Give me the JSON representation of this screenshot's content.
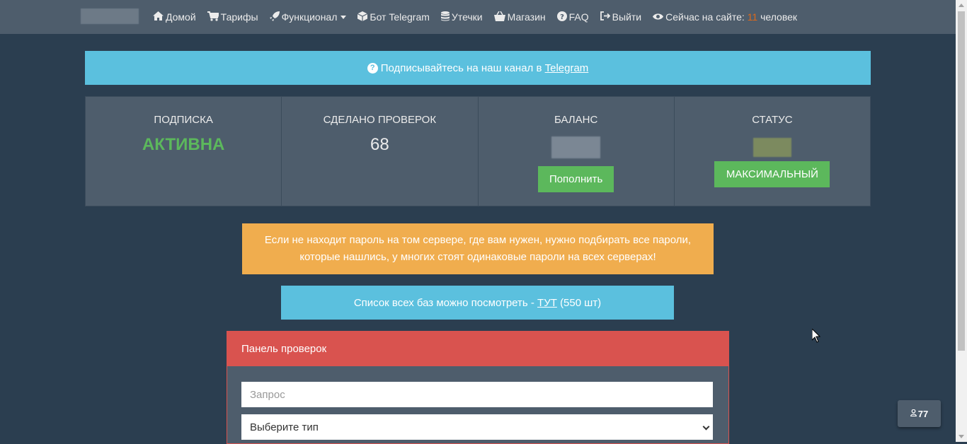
{
  "nav": {
    "items": [
      {
        "icon": "home-icon",
        "glyph": "⌂",
        "label": "Домой"
      },
      {
        "icon": "cart-icon",
        "glyph": "🛒",
        "label": "Тарифы"
      },
      {
        "icon": "rocket-icon",
        "glyph": "🚀",
        "label": "Функционал",
        "dropdown": true
      },
      {
        "icon": "cube-icon",
        "glyph": "⬢",
        "label": "Бот Telegram"
      },
      {
        "icon": "database-icon",
        "glyph": "≣",
        "label": "Утечки"
      },
      {
        "icon": "basket-icon",
        "glyph": "🧺",
        "label": "Магазин"
      },
      {
        "icon": "question-circle-icon",
        "glyph": "?",
        "label": "FAQ"
      },
      {
        "icon": "sign-out-icon",
        "glyph": "⇥",
        "label": "Выйти"
      }
    ],
    "online": {
      "prefix": "Сейчас на сайте:",
      "count": "11",
      "suffix": "человек"
    }
  },
  "telegram_banner": {
    "text": "Подписывайтесь на наш канал в",
    "link": "Telegram"
  },
  "stats": {
    "subscription": {
      "title": "ПОДПИСКА",
      "value": "АКТИВНА"
    },
    "checks": {
      "title": "СДЕЛАНО ПРОВЕРОК",
      "value": "68"
    },
    "balance": {
      "title": "БАЛАНС",
      "button": "Пополнить"
    },
    "status": {
      "title": "СТАТУС",
      "button": "МАКСИМАЛЬНЫЙ"
    }
  },
  "warning": {
    "line1": "Если не находит пароль на том сервере, где вам нужен, нужно подбирать все пароли,",
    "line2": "которые нашлись, у многих стоят одинаковые пароли на всех серверах!"
  },
  "bases": {
    "prefix": "Список всех баз можно посмотреть -",
    "link": "ТУТ",
    "suffix": "(550 шт)"
  },
  "check_panel": {
    "title": "Панель проверок",
    "query_placeholder": "Запрос",
    "type_select": "Выберите тип"
  },
  "online_badge": {
    "count": "77"
  },
  "colors": {
    "background": "#2b3e50",
    "navbar": "#4e5d6c",
    "info": "#5bc0de",
    "success": "#5cb85c",
    "warning": "#f0ad4e",
    "danger": "#d9534f",
    "accent": "#df691a"
  }
}
